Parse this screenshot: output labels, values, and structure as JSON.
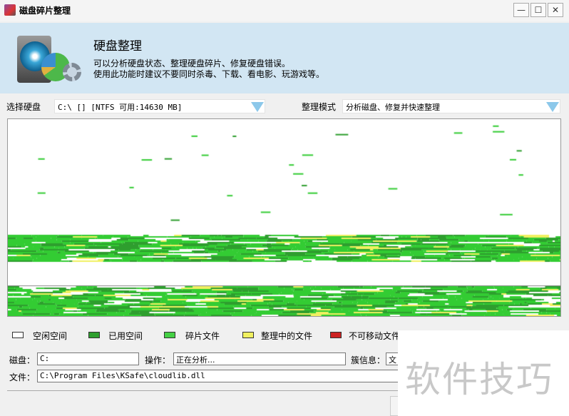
{
  "window": {
    "title": "磁盘碎片整理",
    "min": "—",
    "max": "☐",
    "close": "✕"
  },
  "header": {
    "title": "硬盘整理",
    "line1": "可以分析硬盘状态、整理硬盘碎片、修复硬盘错误。",
    "line2": "使用此功能时建议不要同时杀毒、下载、看电影、玩游戏等。"
  },
  "selectors": {
    "disk_label": "选择硬盘",
    "disk_value": "C:\\ [] [NTFS 可用:14630 MB]",
    "mode_label": "整理模式",
    "mode_value": "分析磁盘、修复并快速整理"
  },
  "colors": {
    "free": "#ffffff",
    "used": "#2e9e2e",
    "fragment": "#33cc33",
    "moving": "#f0f060",
    "unmovable": "#cc2222"
  },
  "legend": [
    {
      "label": "空闲空间",
      "color": "#ffffff"
    },
    {
      "label": "已用空间",
      "color": "#2e9e2e"
    },
    {
      "label": "碎片文件",
      "color": "#44d044"
    },
    {
      "label": "整理中的文件",
      "color": "#f0f060"
    },
    {
      "label": "不可移动文件",
      "color": "#cc2222"
    }
  ],
  "status": {
    "disk_label": "磁盘：",
    "disk_value": "C:",
    "op_label": "操作：",
    "op_value": "正在分析...",
    "cluster_label": "簇信息：",
    "cluster_value": "文",
    "file_label": "文件：",
    "file_value": "C:\\Program Files\\KSafe\\cloudlib.dll"
  },
  "watermark": "软件技巧"
}
